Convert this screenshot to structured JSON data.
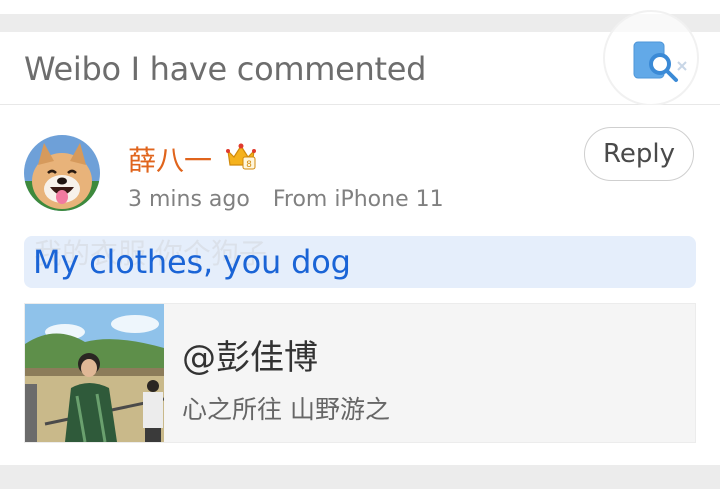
{
  "header": {
    "title": "Weibo I have commented",
    "search_icon": "search-icon"
  },
  "comment": {
    "username": "薛八一",
    "badge_icon": "crown-icon",
    "time": "3 mins ago",
    "source": "From iPhone 11",
    "reply_label": "Reply",
    "translated_text": "My clothes, you dog",
    "original_ghost_text": "我的衣服 你个狗子",
    "quote": {
      "user": "@彭佳博",
      "text": "心之所往 山野游之"
    }
  },
  "colors": {
    "username": "#e0641c",
    "translated": "#1a64d6",
    "translated_bg": "#e5eefb",
    "band": "#ececec"
  }
}
